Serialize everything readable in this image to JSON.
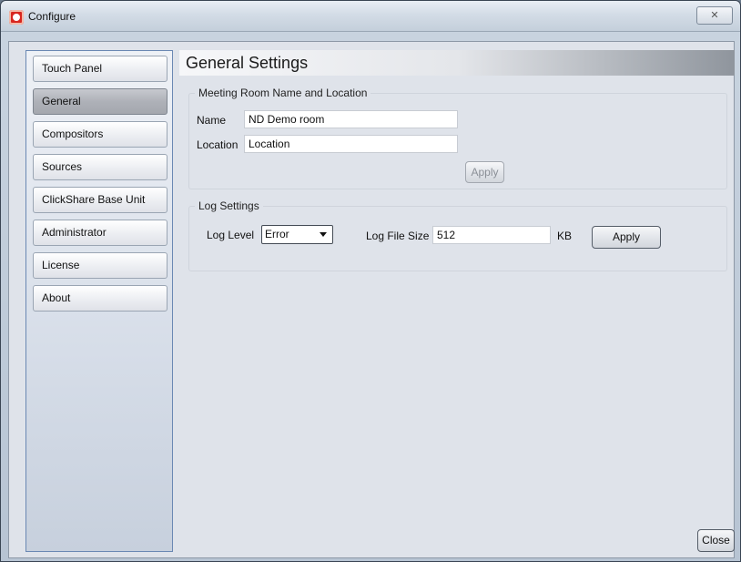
{
  "window": {
    "title": "Configure",
    "close_glyph": "✕"
  },
  "sidebar": {
    "items": [
      {
        "label": "Touch Panel",
        "active": false
      },
      {
        "label": "General",
        "active": true
      },
      {
        "label": "Compositors",
        "active": false
      },
      {
        "label": "Sources",
        "active": false
      },
      {
        "label": "ClickShare Base Unit",
        "active": false
      },
      {
        "label": "Administrator",
        "active": false
      },
      {
        "label": "License",
        "active": false
      },
      {
        "label": "About",
        "active": false
      }
    ]
  },
  "main": {
    "title": "General Settings",
    "meeting_room": {
      "legend": "Meeting Room Name and Location",
      "name_label": "Name",
      "name_value": "ND Demo room",
      "location_label": "Location",
      "location_value": "Location",
      "apply_label": "Apply",
      "apply_enabled": false
    },
    "log": {
      "legend": "Log Settings",
      "level_label": "Log Level",
      "level_value": "Error",
      "size_label": "Log File Size",
      "size_value": "512",
      "size_unit": "KB",
      "apply_label": "Apply"
    },
    "close_label": "Close"
  },
  "colors": {
    "header_gradient_end": "#8f959d",
    "sidebar_border": "#6a88b3"
  }
}
